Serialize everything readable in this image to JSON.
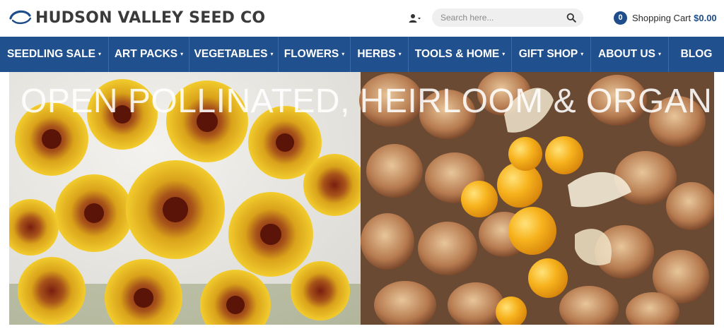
{
  "header": {
    "logo_text": "HUDSON VALLEY SEED CO",
    "search_placeholder": "Search here...",
    "cart": {
      "count": "0",
      "label": "Shopping Cart",
      "total": "$0.00"
    }
  },
  "nav": {
    "items": [
      {
        "label": "SEEDLING SALE",
        "has_dropdown": true
      },
      {
        "label": "ART PACKS",
        "has_dropdown": true
      },
      {
        "label": "VEGETABLES",
        "has_dropdown": true
      },
      {
        "label": "FLOWERS",
        "has_dropdown": true
      },
      {
        "label": "HERBS",
        "has_dropdown": true
      },
      {
        "label": "TOOLS & HOME",
        "has_dropdown": true
      },
      {
        "label": "GIFT SHOP",
        "has_dropdown": true
      },
      {
        "label": "ABOUT US",
        "has_dropdown": true
      },
      {
        "label": "BLOG",
        "has_dropdown": false
      }
    ],
    "caret": "▾"
  },
  "hero": {
    "title": "OPEN POLLINATED, HEIRLOOM & ORGANIC"
  },
  "colors": {
    "nav_bg": "#20508e",
    "accent": "#1f4d8c",
    "logo_text": "#3a3a3a"
  },
  "icons": {
    "logo": "leaf-swoosh-icon",
    "user": "user-icon",
    "search": "search-icon",
    "caret": "chevron-down-icon"
  }
}
